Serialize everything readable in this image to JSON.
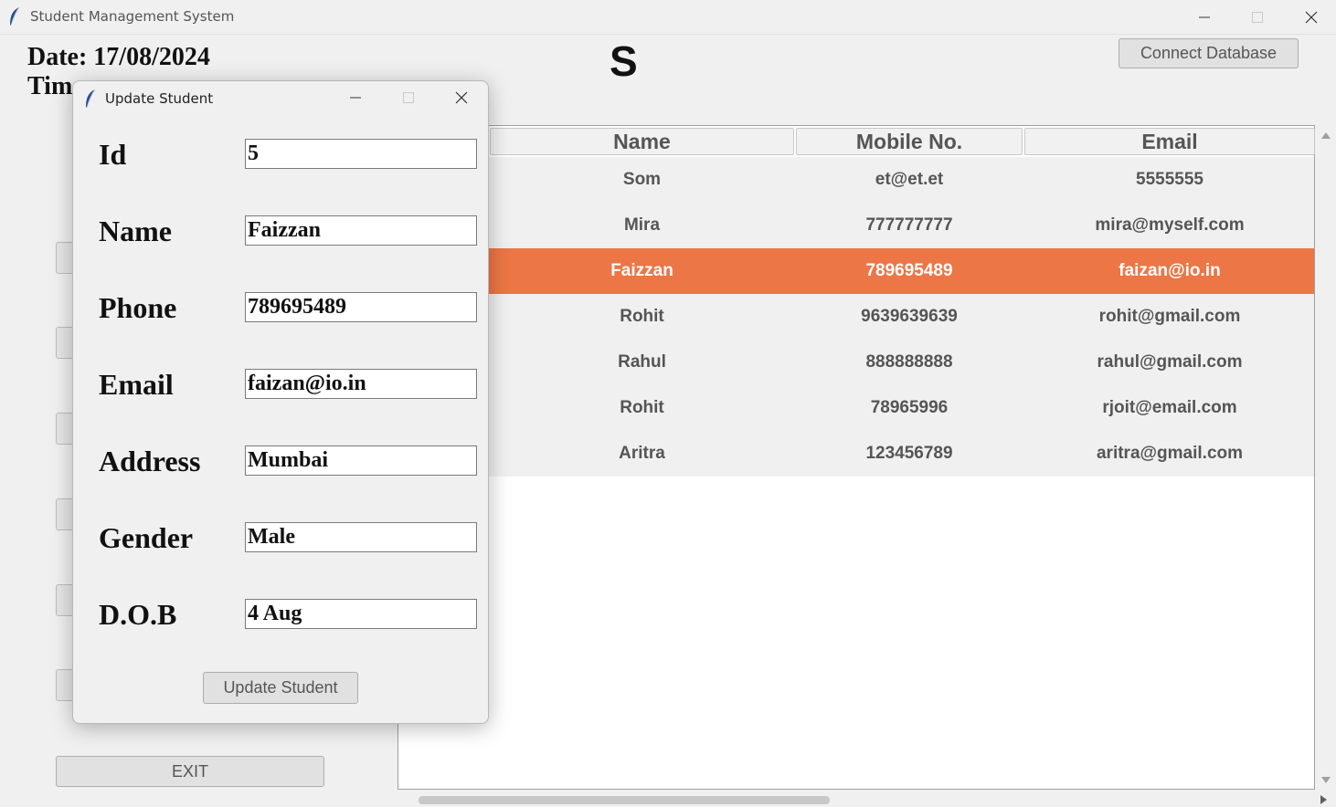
{
  "window": {
    "title": "Student Management System"
  },
  "header": {
    "date_text": "Date: 17/08/2024",
    "time_text": "Tim",
    "slider_text": "S",
    "connect_button": "Connect Database"
  },
  "exit_button": "EXIT",
  "table": {
    "columns": [
      "Name",
      "Mobile No.",
      "Email"
    ],
    "rows": [
      {
        "name": "Som",
        "mobile": "et@et.et",
        "email": "5555555",
        "selected": false
      },
      {
        "name": "Mira",
        "mobile": "777777777",
        "email": "mira@myself.com",
        "selected": false
      },
      {
        "name": "Faizzan",
        "mobile": "789695489",
        "email": "faizan@io.in",
        "selected": true
      },
      {
        "name": "Rohit",
        "mobile": "9639639639",
        "email": "rohit@gmail.com",
        "selected": false
      },
      {
        "name": "Rahul",
        "mobile": "888888888",
        "email": "rahul@gmail.com",
        "selected": false
      },
      {
        "name": "Rohit",
        "mobile": "78965996",
        "email": "rjoit@email.com",
        "selected": false
      },
      {
        "name": "Aritra",
        "mobile": "123456789",
        "email": "aritra@gmail.com",
        "selected": false
      }
    ],
    "selected_color": "#ec7645"
  },
  "dialog": {
    "title": "Update Student",
    "fields": [
      {
        "label": "Id",
        "value": "5"
      },
      {
        "label": "Name",
        "value": "Faizzan"
      },
      {
        "label": "Phone",
        "value": "789695489"
      },
      {
        "label": "Email",
        "value": "faizan@io.in"
      },
      {
        "label": "Address",
        "value": "Mumbai"
      },
      {
        "label": "Gender",
        "value": "Male"
      },
      {
        "label": "D.O.B",
        "value": "4 Aug"
      }
    ],
    "submit_button": "Update Student"
  },
  "icons": [
    "feather-icon",
    "minimize-icon",
    "maximize-icon",
    "close-icon",
    "scroll-up-arrow-icon",
    "scroll-down-arrow-icon",
    "scroll-right-arrow-icon"
  ]
}
